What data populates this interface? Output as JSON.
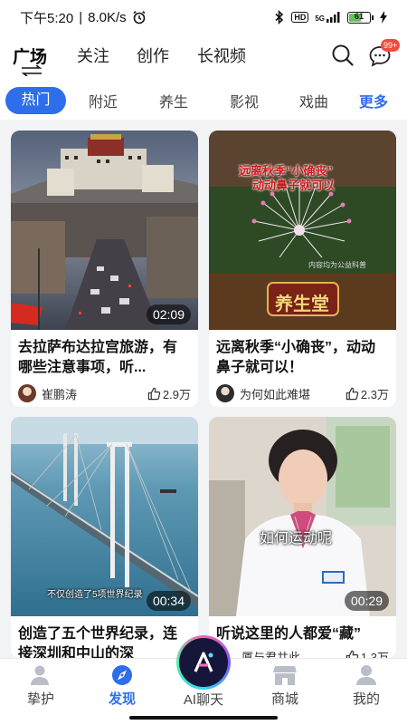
{
  "status_bar": {
    "time": "下午5:20",
    "separator": "|",
    "network_speed": "8.0K/s",
    "hd_label": "HD",
    "signal_label": "5G",
    "battery_level": "61",
    "battery_percent": 61
  },
  "header": {
    "tabs": [
      "广场",
      "关注",
      "创作",
      "长视频"
    ],
    "active_tab_index": 0,
    "message_badge": "99+"
  },
  "categories": {
    "items": [
      "热门",
      "附近",
      "养生",
      "影视",
      "戏曲"
    ],
    "active_index": 0,
    "more_label": "更多"
  },
  "cards": [
    {
      "title": "去拉萨布达拉宫旅游，有哪些注意事项，听...",
      "duration": "02:09",
      "author": "崔鹏涛",
      "likes": "2.9万"
    },
    {
      "title": "远离秋季“小确丧”，动动鼻子就可以！",
      "duration": "",
      "author": "为何如此难堪",
      "likes": "2.3万",
      "overlay_title_line1": "远离秋季“小确丧”",
      "overlay_title_line2": "动动鼻子就可以",
      "overlay_logo": "养生堂",
      "overlay_watermark": "内容均为公益科普"
    },
    {
      "title": "创造了五个世界纪录，连接深圳和中山的深",
      "duration": "00:34",
      "author": "",
      "likes": "",
      "subtitle": "不仅创造了5项世界纪录"
    },
    {
      "title": "听说这里的人都爱“藏”",
      "duration": "00:29",
      "author": "厦与君共此",
      "likes": "1.3万",
      "subtitle": "如何运动呢"
    }
  ],
  "bottom_nav": {
    "items": [
      "挚护",
      "发现",
      "AI聊天",
      "商城",
      "我的"
    ],
    "active_index": 1
  },
  "colors": {
    "accent": "#2d6eea",
    "badge": "#f24b3f",
    "background": "#f2f3f5"
  },
  "icons": [
    "search-icon",
    "message-icon",
    "swap-icon",
    "thumbs-up-icon",
    "compass-icon",
    "user-icon",
    "shop-icon",
    "bluetooth-icon",
    "alarm-icon",
    "signal-icon",
    "battery-icon",
    "charging-icon"
  ]
}
